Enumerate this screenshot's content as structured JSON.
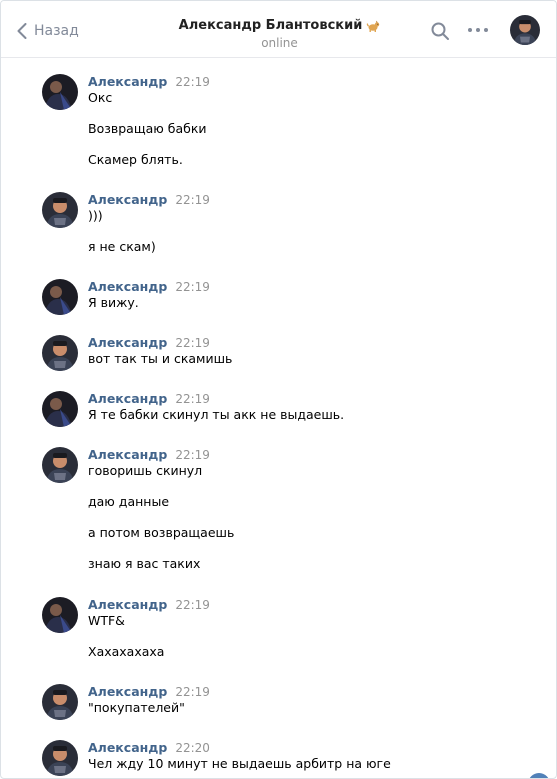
{
  "header": {
    "back_label": "Назад",
    "peer_name": "Александр Блантовский",
    "peer_status": "online"
  },
  "icons": {
    "back": "chevron-left-icon",
    "search": "search-icon",
    "more": "more-horizontal-icon",
    "dog": "dog-emoji-icon"
  },
  "colors": {
    "author": "#42648b",
    "time": "#939393",
    "back": "#828a99",
    "accent": "#5181b8"
  },
  "messages": [
    {
      "author": "Александр",
      "time": "22:19",
      "lines": [
        "Окс",
        "Возвращаю бабки",
        "Скамер блять."
      ]
    },
    {
      "author": "Александр",
      "time": "22:19",
      "lines": [
        ")))",
        "я не скам)"
      ]
    },
    {
      "author": "Александр",
      "time": "22:19",
      "lines": [
        "Я вижу."
      ]
    },
    {
      "author": "Александр",
      "time": "22:19",
      "lines": [
        "вот так ты и скамишь"
      ]
    },
    {
      "author": "Александр",
      "time": "22:19",
      "lines": [
        "Я те бабки скинул ты акк не выдаешь."
      ]
    },
    {
      "author": "Александр",
      "time": "22:19",
      "lines": [
        "говоришь скинул",
        "даю данные",
        "а потом возвращаешь",
        "знаю я вас таких"
      ]
    },
    {
      "author": "Александр",
      "time": "22:19",
      "lines": [
        "WTF&",
        "Хахахахаха"
      ]
    },
    {
      "author": "Александр",
      "time": "22:19",
      "lines": [
        "\"покупателей\""
      ]
    },
    {
      "author": "Александр",
      "time": "22:20",
      "lines": [
        "Чел жду 10 минут не выдаешь арбитр на юге"
      ]
    }
  ]
}
